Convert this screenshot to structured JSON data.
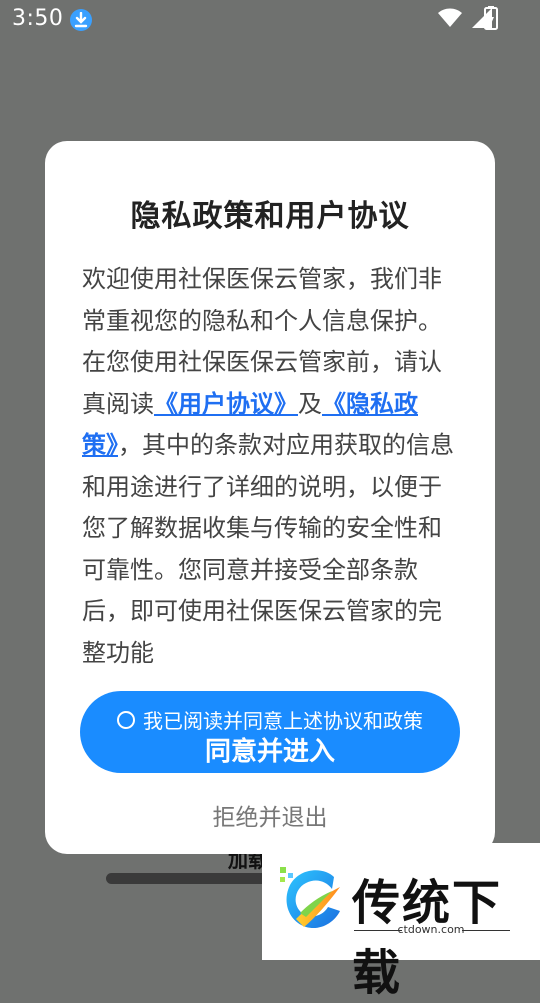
{
  "status_bar": {
    "time": "3:50",
    "download_icon": "download-icon",
    "icons": [
      "wifi-icon",
      "signal-icon",
      "battery-charging-icon"
    ]
  },
  "background": {
    "partial_text": "加载"
  },
  "dialog": {
    "title": "隐私政策和用户协议",
    "body_part1": "欢迎使用社保医保云管家，我们非常重视您的隐私和个人信息保护。在您使用社保医保云管家前，请认真阅读",
    "user_agreement_link": "《用户协议》",
    "and_text": "及",
    "privacy_policy_link": "《隐私政策》",
    "body_part2": "，其中的条款对应用获取的信息和用途进行了详细的说明，以便于您了解数据收集与传输的安全性和可靠性。您同意并接受全部条款后，即可使用社保医保云管家的完整功能",
    "consent_checkbox_label": "我已阅读并同意上述协议和政策",
    "agree_button_label": "同意并进入",
    "refuse_label": "拒绝并退出"
  },
  "watermark": {
    "brand_name": "传统下载",
    "url": "ctdown.com"
  },
  "colors": {
    "accent": "#1a8cff",
    "link": "#1f6ff2",
    "scrim": "#6f716f"
  }
}
